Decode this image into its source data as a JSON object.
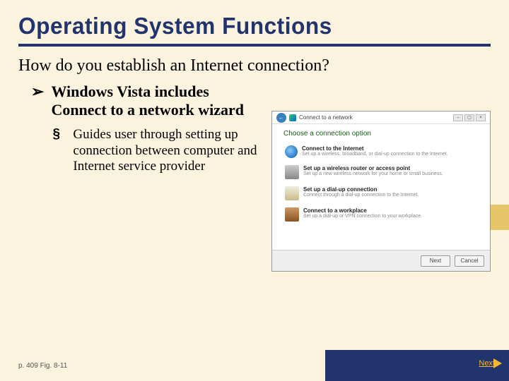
{
  "title": "Operating System Functions",
  "question": "How do you establish an Internet connection?",
  "bullets": {
    "level1": "Windows Vista includes Connect to a network wizard",
    "level2": "Guides user through setting up connection between computer and Internet service provider"
  },
  "screenshot": {
    "window_title": "Connect to a network",
    "heading": "Choose a connection option",
    "options": [
      {
        "title": "Connect to the Internet",
        "subtitle": "Set up a wireless, broadband, or dial-up connection to the Internet."
      },
      {
        "title": "Set up a wireless router or access point",
        "subtitle": "Set up a new wireless network for your home or small business."
      },
      {
        "title": "Set up a dial-up connection",
        "subtitle": "Connect through a dial-up connection to the Internet."
      },
      {
        "title": "Connect to a workplace",
        "subtitle": "Set up a dial-up or VPN connection to your workplace."
      }
    ],
    "buttons": {
      "next": "Next",
      "cancel": "Cancel"
    }
  },
  "citation": "p. 409 Fig. 8-11",
  "next_label": "Next"
}
